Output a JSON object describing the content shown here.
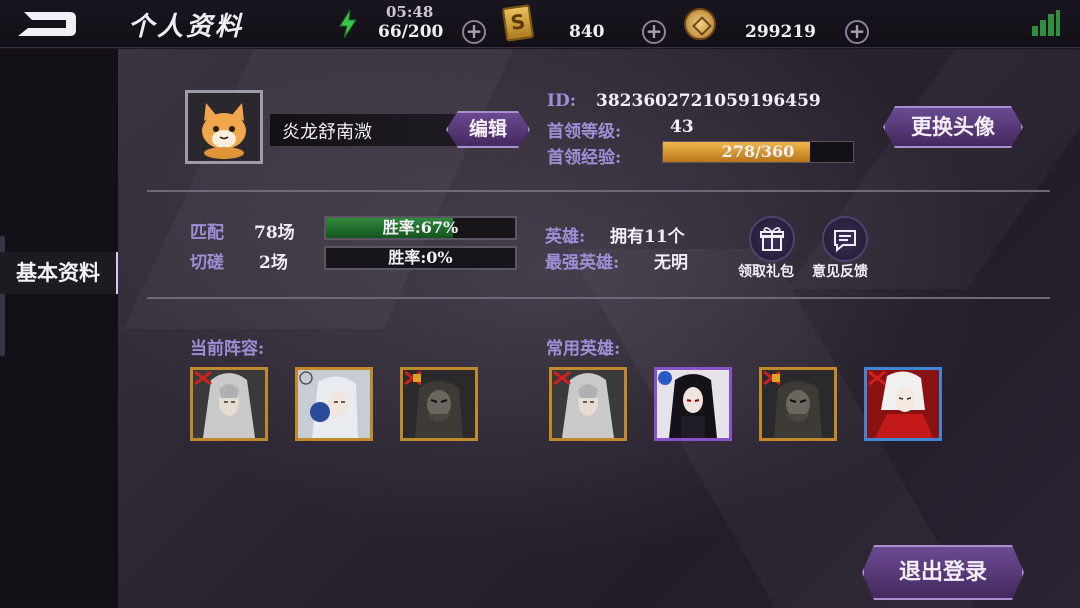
{
  "topbar": {
    "title": "个人资料",
    "time": "05:48",
    "energy": "66/200",
    "cards": "840",
    "gold": "299219"
  },
  "sidebar": {
    "active_tab": "基本资料"
  },
  "profile": {
    "name": "炎龙舒南溦",
    "edit_label": "编辑",
    "id_label": "ID:",
    "id_value": "3823602721059196459",
    "level_label": "首领等级:",
    "level_value": "43",
    "exp_label": "首领经验:",
    "exp_text": "278/360",
    "exp_fraction": 0.772,
    "change_avatar_label": "更换头像"
  },
  "stats": {
    "match_label": "匹配",
    "match_count": "78场",
    "match_rate_text": "胜率:67%",
    "match_rate": 0.67,
    "spar_label": "切磋",
    "spar_count": "2场",
    "spar_rate_text": "胜率:0%",
    "spar_rate": 0,
    "heroes_label": "英雄:",
    "heroes_value": "拥有11个",
    "strongest_label": "最强英雄:",
    "strongest_value": "无明",
    "gift_label": "领取礼包",
    "feedback_label": "意见反馈"
  },
  "lineup": {
    "current_label": "当前阵容:",
    "common_label": "常用英雄:"
  },
  "logout_label": "退出登录",
  "colors": {
    "accent_purple": "#9d8fd6",
    "win_green": "#2f8a3c",
    "exp_gold": "#f0b64a",
    "hero_frame_gold": "#c08a2a",
    "hero_frame_purple": "#8a52c8",
    "hero_frame_blue": "#3f86d6"
  }
}
